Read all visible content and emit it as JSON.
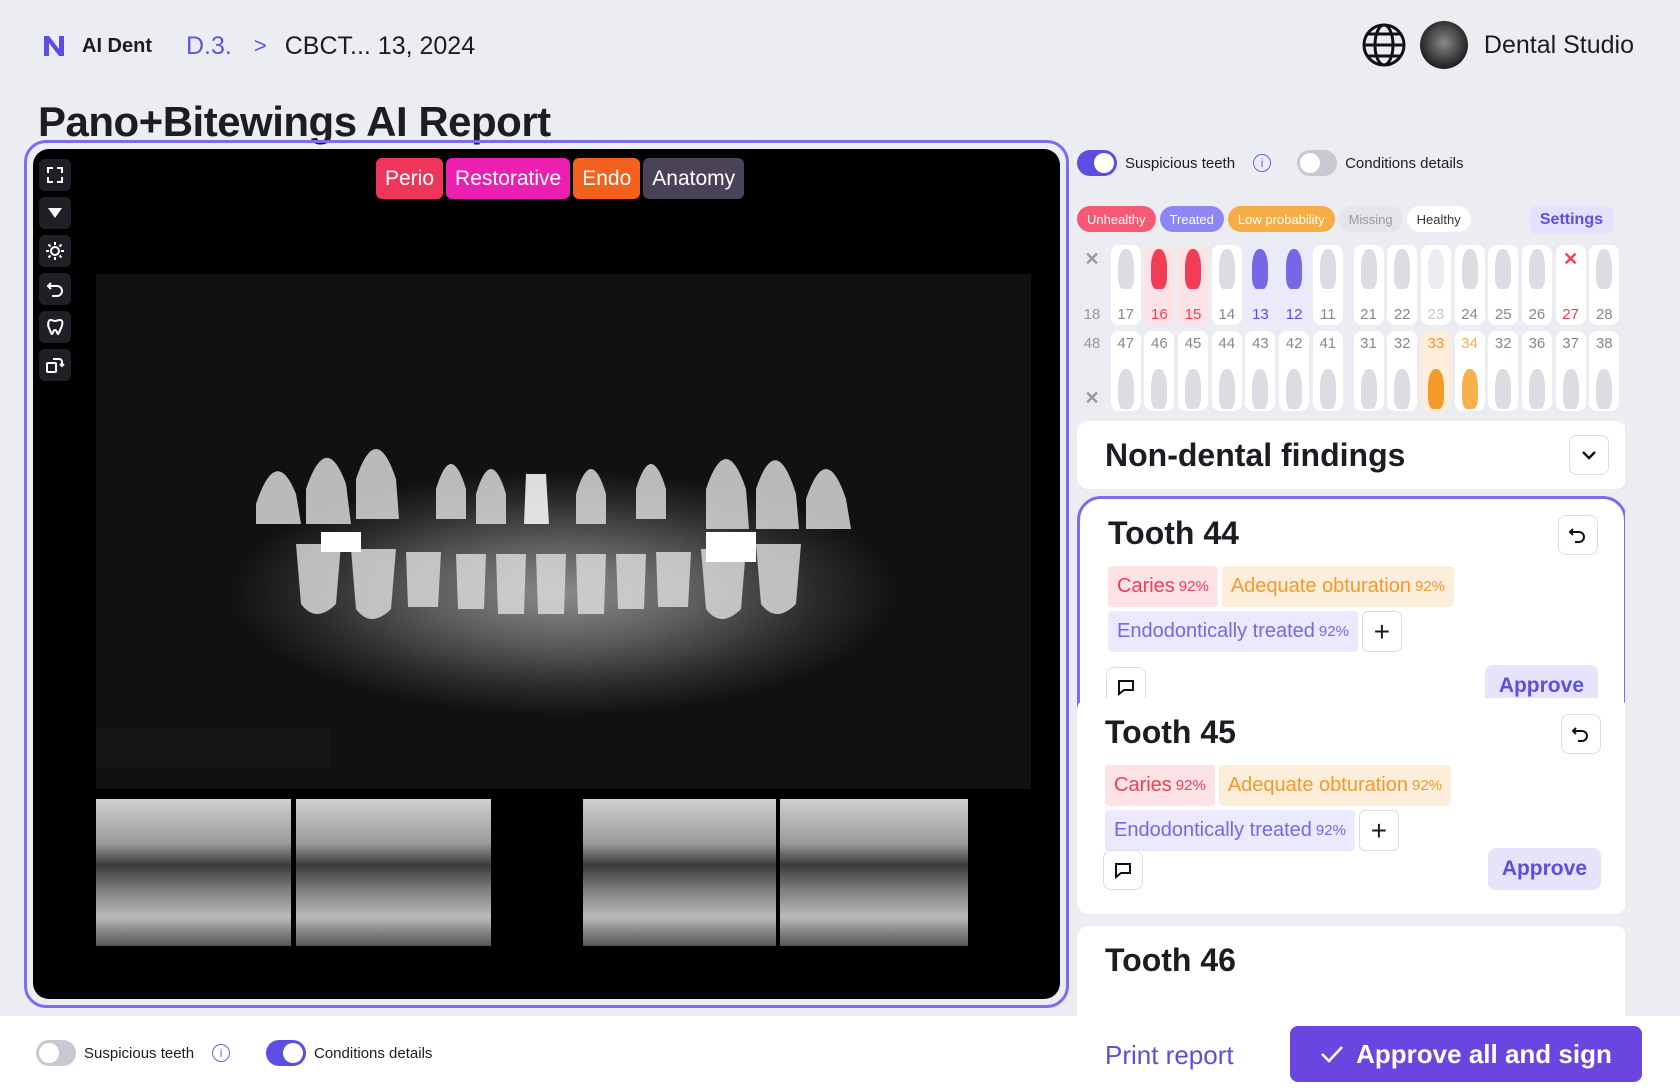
{
  "header": {
    "brand": "AI Dent",
    "crumb_patient": "D.3.",
    "crumb_separator": ">",
    "crumb_study": "CBCT... 13, 2024",
    "studio": "Dental Studio"
  },
  "page_title": "Pano+Bitewings AI Report",
  "viewer": {
    "tabs": [
      {
        "label": "Perio",
        "color": "#f0355a"
      },
      {
        "label": "Restorative",
        "color": "#ec1fb0"
      },
      {
        "label": "Endo",
        "color": "#f4601e"
      },
      {
        "label": "Anatomy",
        "color": "#4a4358"
      }
    ],
    "tools": [
      "expand-icon",
      "filter-icon",
      "brightness-icon",
      "undo-icon",
      "tooth-search-icon",
      "rotate-icon"
    ]
  },
  "panel": {
    "toggles": [
      {
        "label": "Suspicious teeth",
        "on": true
      },
      {
        "label": "Conditions details",
        "on": false
      }
    ],
    "legend": [
      {
        "label": "Unhealthy",
        "bg": "#f45a73",
        "fg": "#ffffff"
      },
      {
        "label": "Treated",
        "bg": "#8e86f5",
        "fg": "#ffffff"
      },
      {
        "label": "Low probability",
        "bg": "#f7ad45",
        "fg": "#ffffff"
      },
      {
        "label": "Missing",
        "bg": "#e4e4ea",
        "fg": "#9a9aa6"
      },
      {
        "label": "Healthy",
        "bg": "#ffffff",
        "fg": "#333333"
      }
    ],
    "settings_label": "Settings",
    "upper_teeth": [
      {
        "n": "18",
        "state": "missing"
      },
      {
        "n": "17",
        "state": "healthy"
      },
      {
        "n": "16",
        "state": "unhealthy"
      },
      {
        "n": "15",
        "state": "unhealthy"
      },
      {
        "n": "14",
        "state": "healthy"
      },
      {
        "n": "13",
        "state": "treated"
      },
      {
        "n": "12",
        "state": "treated"
      },
      {
        "n": "11",
        "state": "healthy"
      },
      {
        "n": "21",
        "state": "healthy"
      },
      {
        "n": "22",
        "state": "healthy"
      },
      {
        "n": "23",
        "state": "faded"
      },
      {
        "n": "24",
        "state": "healthy"
      },
      {
        "n": "25",
        "state": "healthy"
      },
      {
        "n": "26",
        "state": "healthy"
      },
      {
        "n": "27",
        "state": "missing-red"
      },
      {
        "n": "28",
        "state": "healthy"
      }
    ],
    "lower_teeth": [
      {
        "n": "48",
        "state": "missing"
      },
      {
        "n": "47",
        "state": "healthy"
      },
      {
        "n": "46",
        "state": "healthy"
      },
      {
        "n": "45",
        "state": "healthy"
      },
      {
        "n": "44",
        "state": "healthy"
      },
      {
        "n": "43",
        "state": "healthy"
      },
      {
        "n": "42",
        "state": "healthy"
      },
      {
        "n": "41",
        "state": "healthy"
      },
      {
        "n": "31",
        "state": "healthy"
      },
      {
        "n": "32",
        "state": "healthy"
      },
      {
        "n": "33",
        "state": "low"
      },
      {
        "n": "34",
        "state": "low-faded"
      },
      {
        "n": "32",
        "state": "healthy"
      },
      {
        "n": "36",
        "state": "healthy"
      },
      {
        "n": "37",
        "state": "healthy"
      },
      {
        "n": "38",
        "state": "healthy"
      }
    ],
    "nondental_title": "Non-dental findings",
    "cards": [
      {
        "title": "Tooth 44",
        "selected": true,
        "chips": [
          {
            "label": "Caries",
            "pct": "92%",
            "kind": "red"
          },
          {
            "label": "Adequate obturation",
            "pct": "92%",
            "kind": "orange"
          },
          {
            "label": "Endodontically treated",
            "pct": "92%",
            "kind": "purple"
          }
        ],
        "approve": "Approve"
      },
      {
        "title": "Tooth 45",
        "selected": false,
        "chips": [
          {
            "label": "Caries",
            "pct": "92%",
            "kind": "red"
          },
          {
            "label": "Adequate obturation",
            "pct": "92%",
            "kind": "orange"
          },
          {
            "label": "Endodontically treated",
            "pct": "92%",
            "kind": "purple"
          }
        ],
        "approve": "Approve"
      },
      {
        "title": "Tooth 46"
      }
    ]
  },
  "footer": {
    "toggles": [
      {
        "label": "Suspicious teeth",
        "on": false
      },
      {
        "label": "Conditions details",
        "on": true
      }
    ],
    "print": "Print report",
    "sign": "Approve all and sign"
  }
}
